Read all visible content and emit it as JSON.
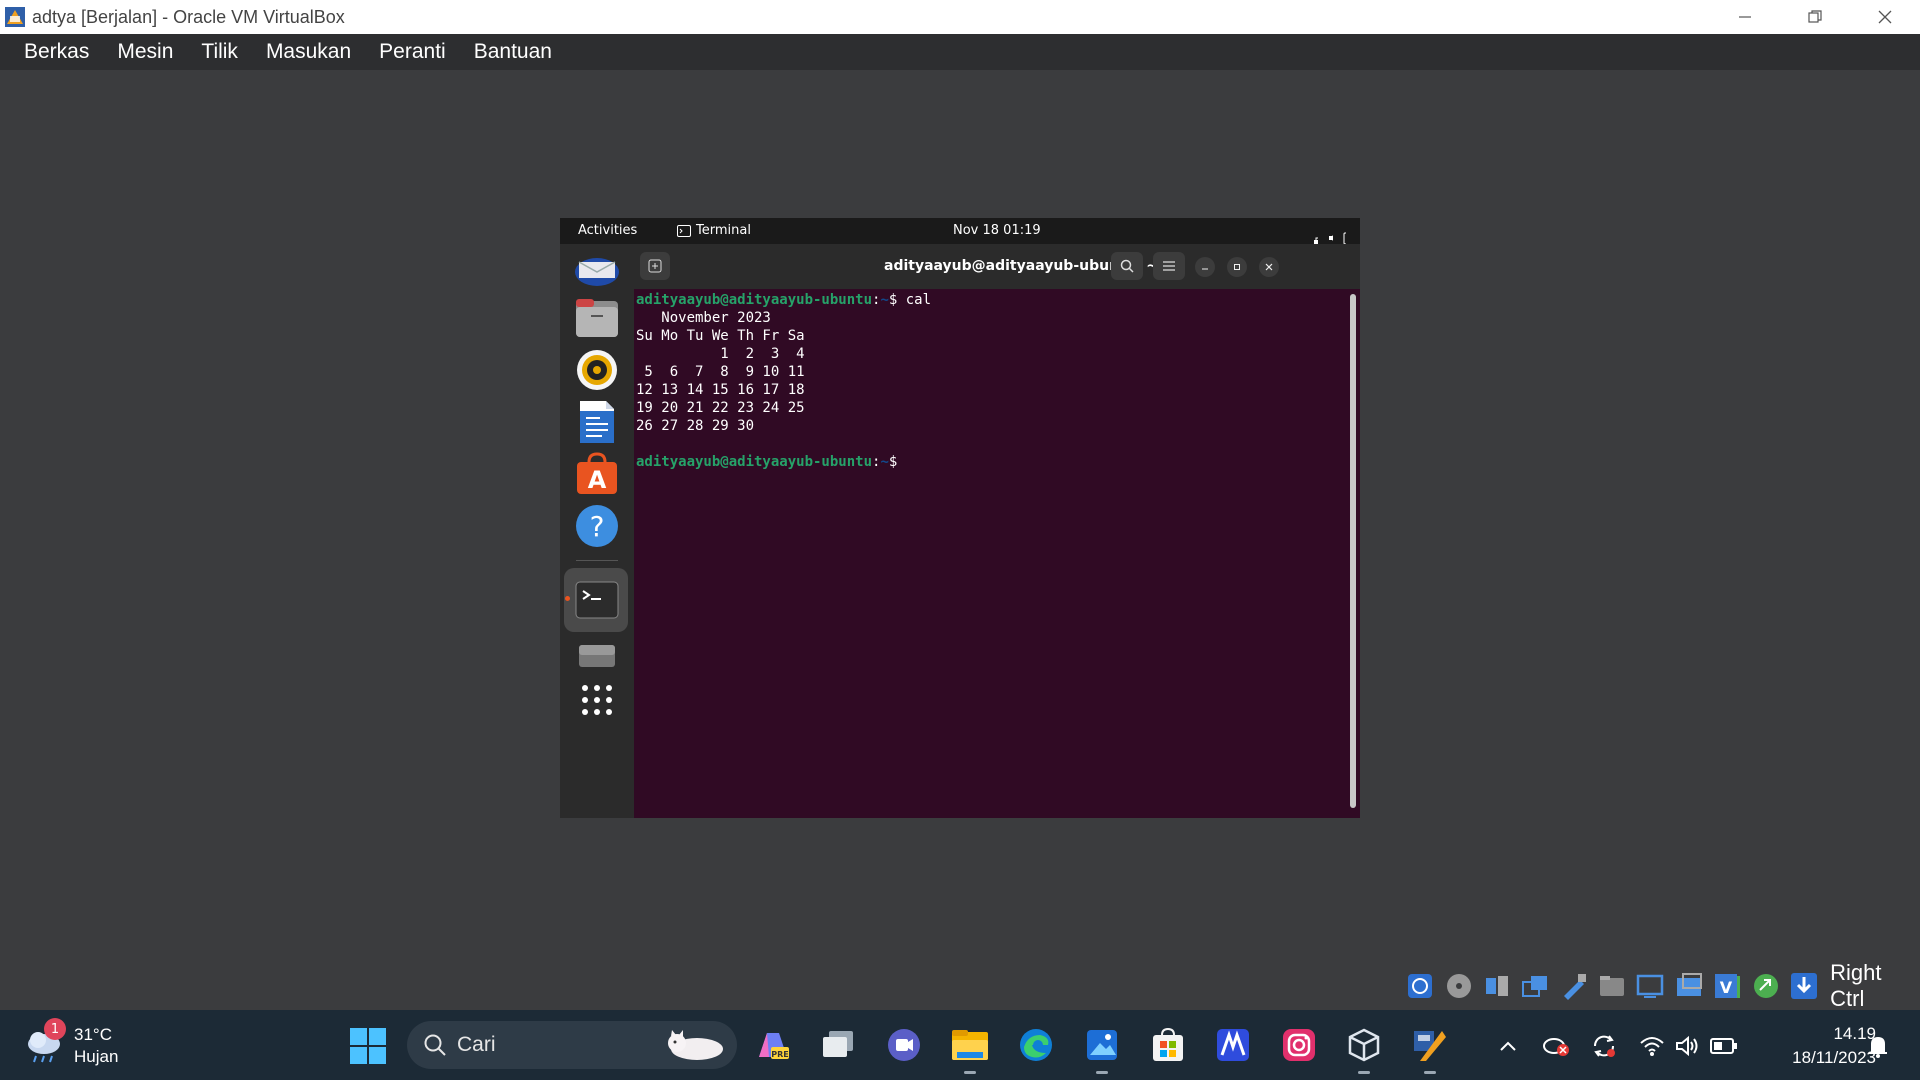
{
  "host_window": {
    "title": "adtya [Berjalan] - Oracle VM VirtualBox",
    "menu": [
      "Berkas",
      "Mesin",
      "Tilik",
      "Masukan",
      "Peranti",
      "Bantuan"
    ]
  },
  "guest": {
    "topbar": {
      "activities": "Activities",
      "app_name": "Terminal",
      "clock": "Nov 18  01:19"
    },
    "dock": [
      {
        "name": "thunderbird-icon"
      },
      {
        "name": "files-icon"
      },
      {
        "name": "rhythmbox-icon"
      },
      {
        "name": "writer-icon"
      },
      {
        "name": "software-icon"
      },
      {
        "name": "help-icon"
      },
      {
        "name": "terminal-icon",
        "active": true
      },
      {
        "name": "disk-icon"
      },
      {
        "name": "app-grid-icon"
      }
    ],
    "terminal": {
      "window_title": "adityaayub@adityaayub-ubuntu: ~",
      "prompt_user": "adityaayub@adityaayub-ubuntu",
      "prompt_path": "~",
      "command": "cal",
      "output": [
        "   November 2023",
        "Su Mo Tu We Th Fr Sa",
        "          1  2  3  4",
        " 5  6  7  8  9 10 11",
        "12 13 14 15 16 17 18",
        "19 20 21 22 23 24 25",
        "26 27 28 29 30",
        ""
      ]
    }
  },
  "host_status": {
    "host_key": "Right Ctrl"
  },
  "taskbar": {
    "weather_temp": "31°C",
    "weather_desc": "Hujan",
    "weather_badge": "1",
    "search_placeholder": "Cari",
    "time": "14.19",
    "date": "18/11/2023"
  }
}
